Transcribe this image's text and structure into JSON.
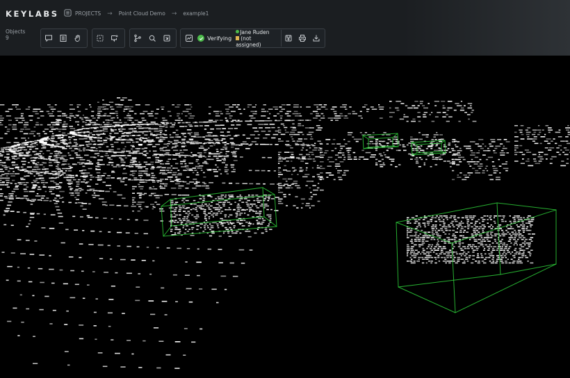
{
  "app": {
    "logo": "KEYLABS"
  },
  "breadcrumb": {
    "projects": "PROJECTS",
    "project": "Point Cloud Demo",
    "item": "example1"
  },
  "objects": {
    "label": "Objects",
    "count": "9"
  },
  "toolbar": {
    "group1": [
      "comment-icon",
      "list-icon",
      "hand-icon"
    ],
    "group2": [
      "select-box-icon",
      "comment-add-icon"
    ],
    "group3": [
      "branch-icon",
      "search-refresh-icon",
      "crop-icon"
    ],
    "status_label": "Verifying",
    "assignee": "Jane Ruden",
    "assignee_secondary": "(not assigned)",
    "group4": [
      "save-icon",
      "print-icon",
      "download-icon"
    ]
  },
  "colors": {
    "accent": "#4cbb4a",
    "bbox": "#2ecf3a",
    "topbar": "#1b1e21"
  }
}
